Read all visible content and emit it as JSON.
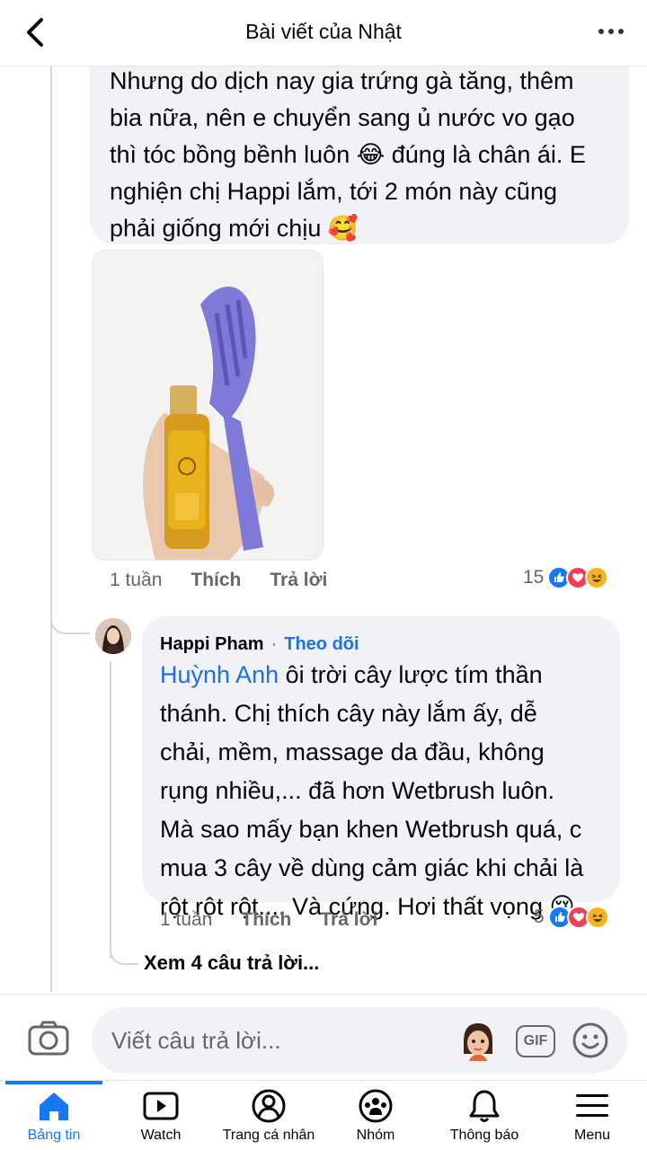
{
  "header": {
    "title": "Bài viết của Nhật"
  },
  "comment1": {
    "lines": [
      "Nhưng do dịch nay gia trứng gà tăng, thêm",
      "bia nữa, nên e chuyển sang ủ nước vo gạo",
      "thì tóc bồng bềnh luôn 😂 đúng là chân ái. E",
      "nghiện chị Happi lắm, tới 2 món này cũng",
      "phải giống mới chịu 🥰"
    ],
    "time": "1 tuần",
    "like_label": "Thích",
    "reply_label": "Trả lời",
    "reaction_count": "15",
    "reactions": [
      "like-icon",
      "love-icon",
      "haha-icon"
    ]
  },
  "reply1": {
    "author": "Happi Pham",
    "separator": "·",
    "follow_label": "Theo dõi",
    "mention": "Huỳnh Anh",
    "first_line_rest": " ôi trời cây lược tím thần",
    "lines": [
      "thánh. Chị thích cây này lắm ấy, dễ",
      "chải, mềm, massage da đầu, không",
      "rụng nhiều,... đã hơn Wetbrush luôn.",
      "Mà sao mấy bạn khen Wetbrush quá, c",
      "mua 3 cây về dùng cảm giác khi chải là",
      "rột rột rột.... Và cứng. Hơi thất vọng 😢"
    ],
    "time": "1 tuần",
    "like_label": "Thích",
    "reply_label": "Trả lời",
    "reaction_count": "5",
    "reactions": [
      "like-icon",
      "love-icon",
      "haha-icon"
    ]
  },
  "see_more": "Xem 4 câu trả lời...",
  "composer": {
    "placeholder": "Viết câu trả lời...",
    "gif_label": "GIF"
  },
  "tabs": [
    {
      "label": "Bảng tin",
      "icon": "home-icon",
      "active": true
    },
    {
      "label": "Watch",
      "icon": "watch-icon",
      "active": false
    },
    {
      "label": "Trang cá nhân",
      "icon": "profile-icon",
      "active": false
    },
    {
      "label": "Nhóm",
      "icon": "groups-icon",
      "active": false
    },
    {
      "label": "Thông báo",
      "icon": "bell-icon",
      "active": false
    },
    {
      "label": "Menu",
      "icon": "menu-icon",
      "active": false
    }
  ],
  "colors": {
    "accent": "#1877f2",
    "bubble": "#f0f2f5",
    "secondary_text": "#65676b",
    "mention": "#216fdb"
  }
}
